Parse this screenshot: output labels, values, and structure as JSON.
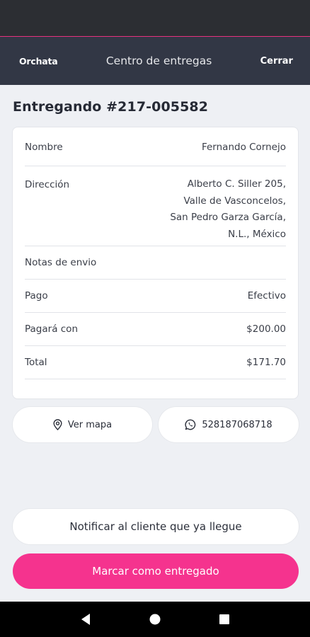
{
  "app_bar": {
    "brand": "Orchata",
    "title": "Centro de entregas",
    "close_label": "Cerrar"
  },
  "order": {
    "title": "Entregando #217-005582"
  },
  "details": {
    "name_label": "Nombre",
    "name_value": "Fernando Cornejo",
    "address_label": "Dirección",
    "address_lines": [
      "Alberto C. Siller 205,",
      "Valle de Vasconcelos,",
      "San Pedro Garza García,",
      "N.L., México"
    ],
    "notes_label": "Notas de envio",
    "payment_label": "Pago",
    "payment_value": "Efectivo",
    "pay_with_label": "Pagará con",
    "pay_with_value": "$200.00",
    "total_label": "Total",
    "total_value": "$171.70"
  },
  "actions": {
    "map_label": "Ver mapa",
    "phone_label": "528187068718",
    "notify_label": "Notificar al cliente que ya llegue",
    "deliver_label": "Marcar como entregado"
  },
  "colors": {
    "accent": "#f5338e",
    "app_bar": "#323745",
    "background": "#eef0f4"
  },
  "icons": {
    "map": "location-pin-icon",
    "phone": "whatsapp-icon",
    "nav": [
      "back-icon",
      "home-icon",
      "recents-icon"
    ]
  }
}
